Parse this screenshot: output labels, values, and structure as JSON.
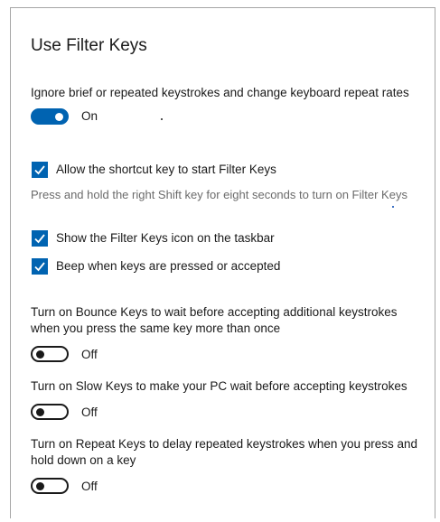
{
  "title": "Use Filter Keys",
  "filter_keys": {
    "description": "Ignore brief or repeated keystrokes and change keyboard repeat rates",
    "toggle_state": "On",
    "enabled": true
  },
  "shortcut": {
    "label": "Allow the shortcut key to start Filter Keys",
    "checked": true,
    "hint": "Press and hold the right Shift key for eight seconds to turn on Filter Keys"
  },
  "show_icon": {
    "label": "Show the Filter Keys icon on the taskbar",
    "checked": true
  },
  "beep": {
    "label": "Beep when keys are pressed or accepted",
    "checked": true
  },
  "bounce_keys": {
    "line1": "Turn on Bounce Keys to wait before accepting additional keystrokes",
    "line2": "when you press the same key more than once",
    "toggle_state": "Off",
    "enabled": false
  },
  "slow_keys": {
    "description": "Turn on Slow Keys to make your PC wait before accepting keystrokes",
    "toggle_state": "Off",
    "enabled": false
  },
  "repeat_keys": {
    "line1": "Turn on Repeat Keys to delay repeated keystrokes when you press and",
    "line2": "hold down on a key",
    "toggle_state": "Off",
    "enabled": false
  },
  "colors": {
    "accent": "#0063b1",
    "text": "#1a1a1a",
    "secondary_text": "#6b6b6b"
  },
  "icons": {
    "checkbox": "checkmark-icon"
  }
}
